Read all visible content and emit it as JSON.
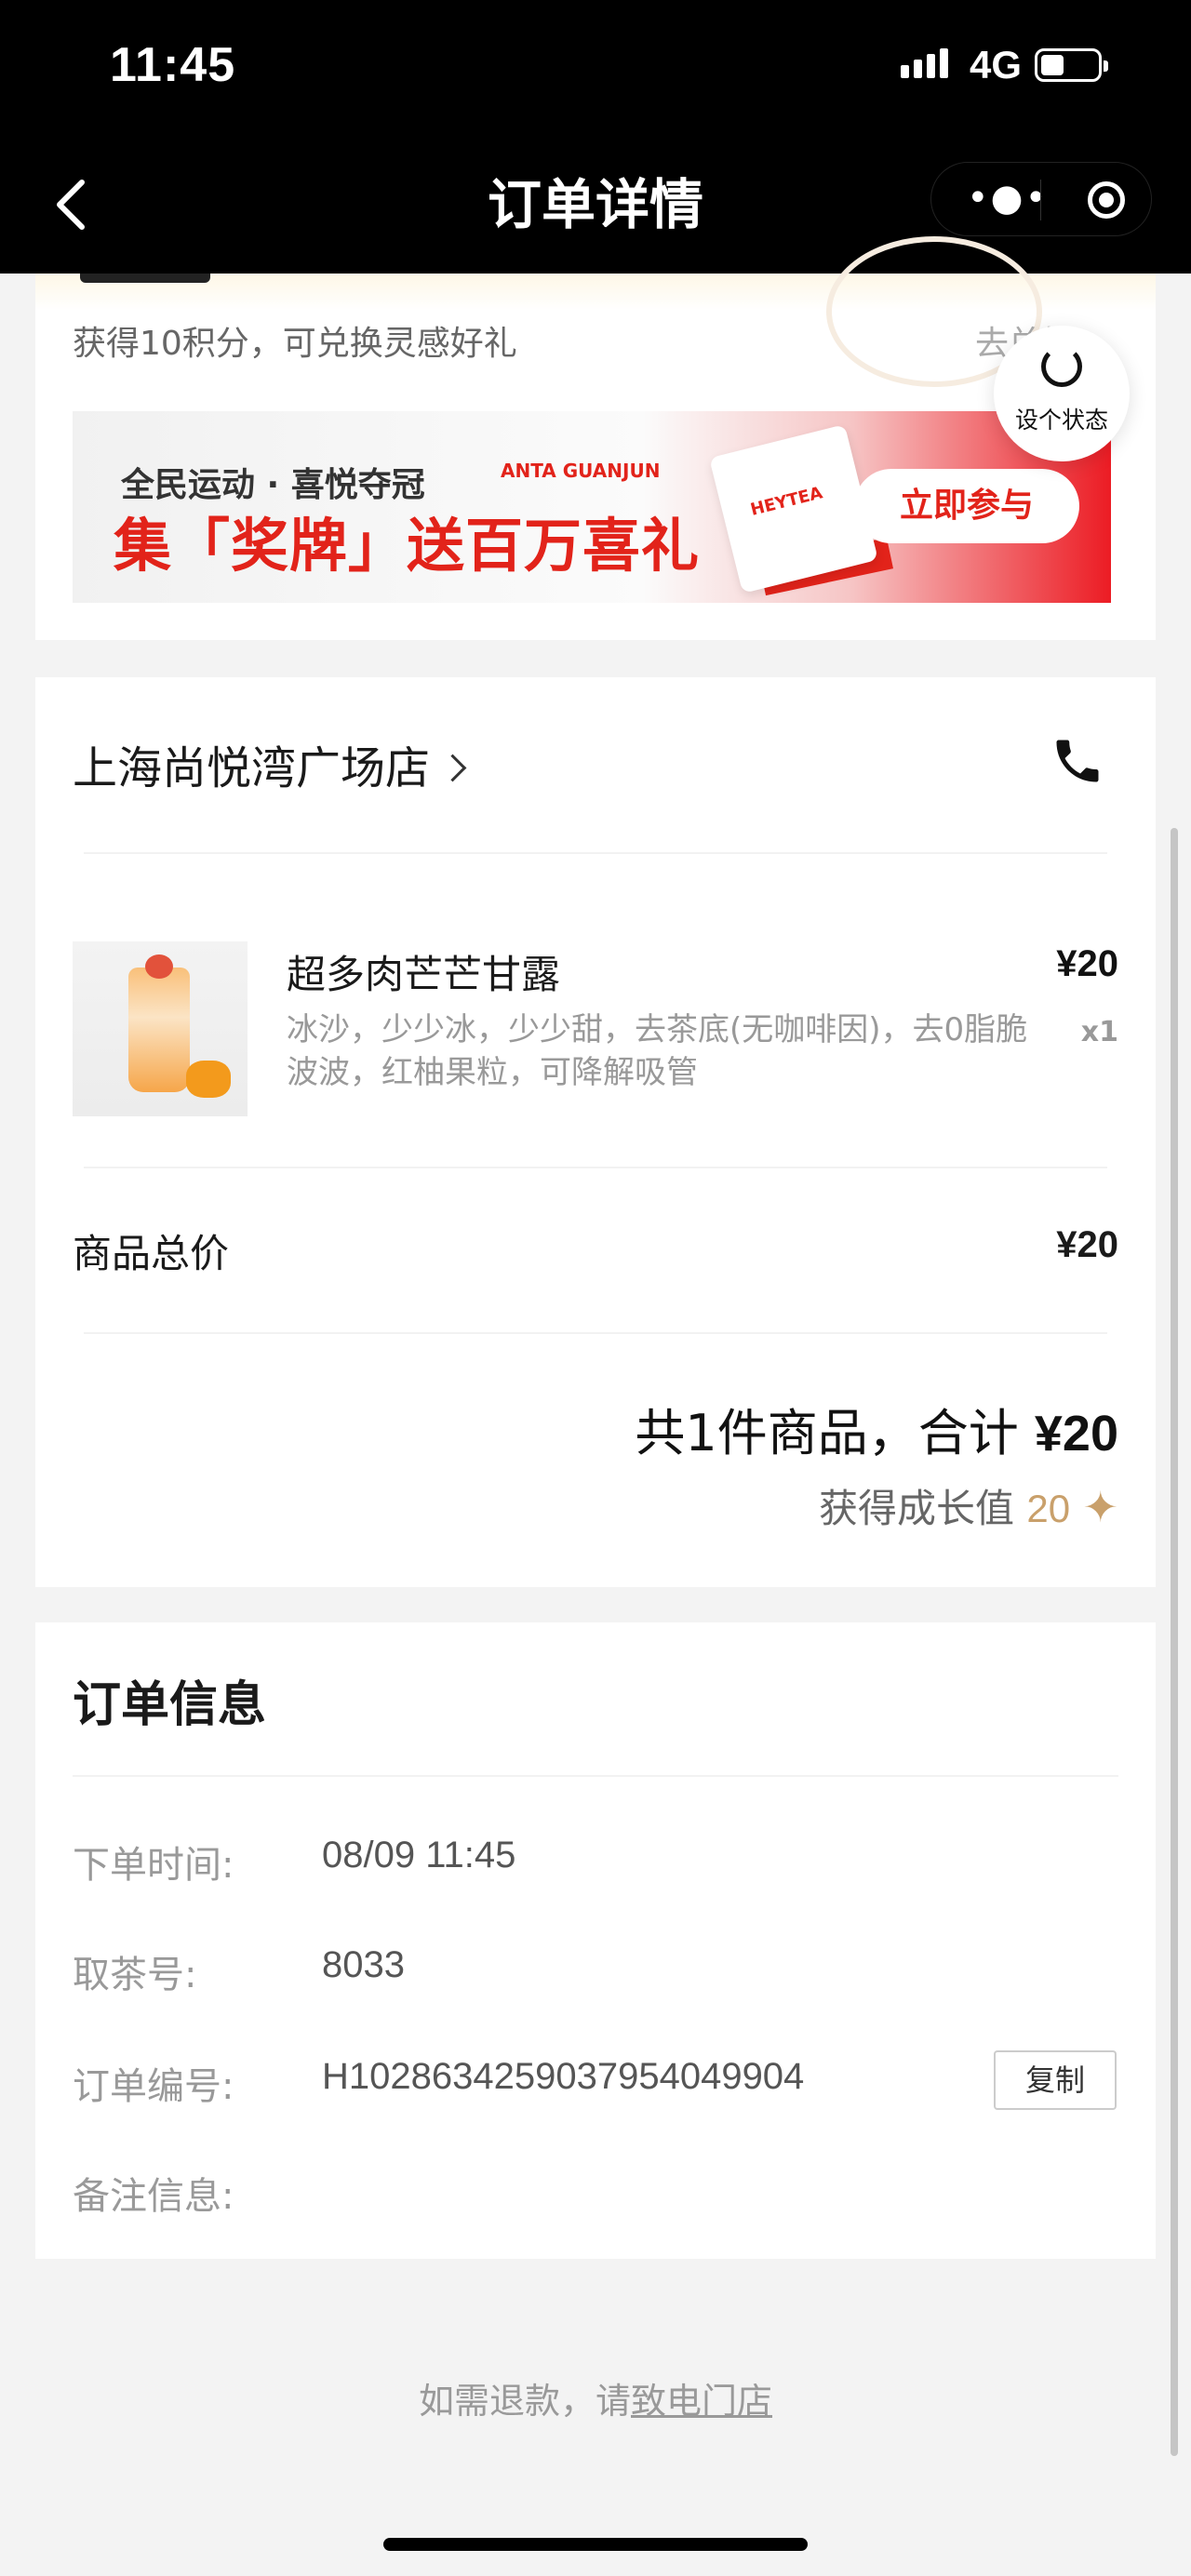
{
  "status_bar": {
    "time": "11:45",
    "network": "4G"
  },
  "nav": {
    "title": "订单详情"
  },
  "points": {
    "text": "获得10积分，可兑换灵感好礼",
    "redeem": "去兑换"
  },
  "fab": {
    "label": "设个状态"
  },
  "banner": {
    "line1": "全民运动 · 喜悦夺冠",
    "brand": "ANTA GUANJUN",
    "line2": "集「奖牌」送百万喜礼",
    "bag_text": "HEYTEA",
    "button": "立即参与"
  },
  "store": {
    "name": "上海尚悦湾广场店"
  },
  "product": {
    "name": "超多肉芒芒甘露",
    "desc": "冰沙，少少冰，少少甜，去茶底(无咖啡因)，去0脂脆波波，红柚果粒，可降解吸管",
    "price": "¥20",
    "qty": "x1"
  },
  "subtotal": {
    "label": "商品总价",
    "value": "¥20"
  },
  "total": {
    "prefix": "共1件商品，合计 ",
    "amount": "¥20"
  },
  "growth": {
    "label": "获得成长值 ",
    "value": "20"
  },
  "order_info": {
    "title": "订单信息",
    "time_label": "下单时间:",
    "time_value": "08/09 11:45",
    "pickup_label": "取茶号:",
    "pickup_value": "8033",
    "number_label": "订单编号:",
    "number_value": "H1028634259037954049904",
    "copy": "复制",
    "note_label": "备注信息:"
  },
  "refund": {
    "prefix": "如需退款，请",
    "link": "致电门店"
  }
}
